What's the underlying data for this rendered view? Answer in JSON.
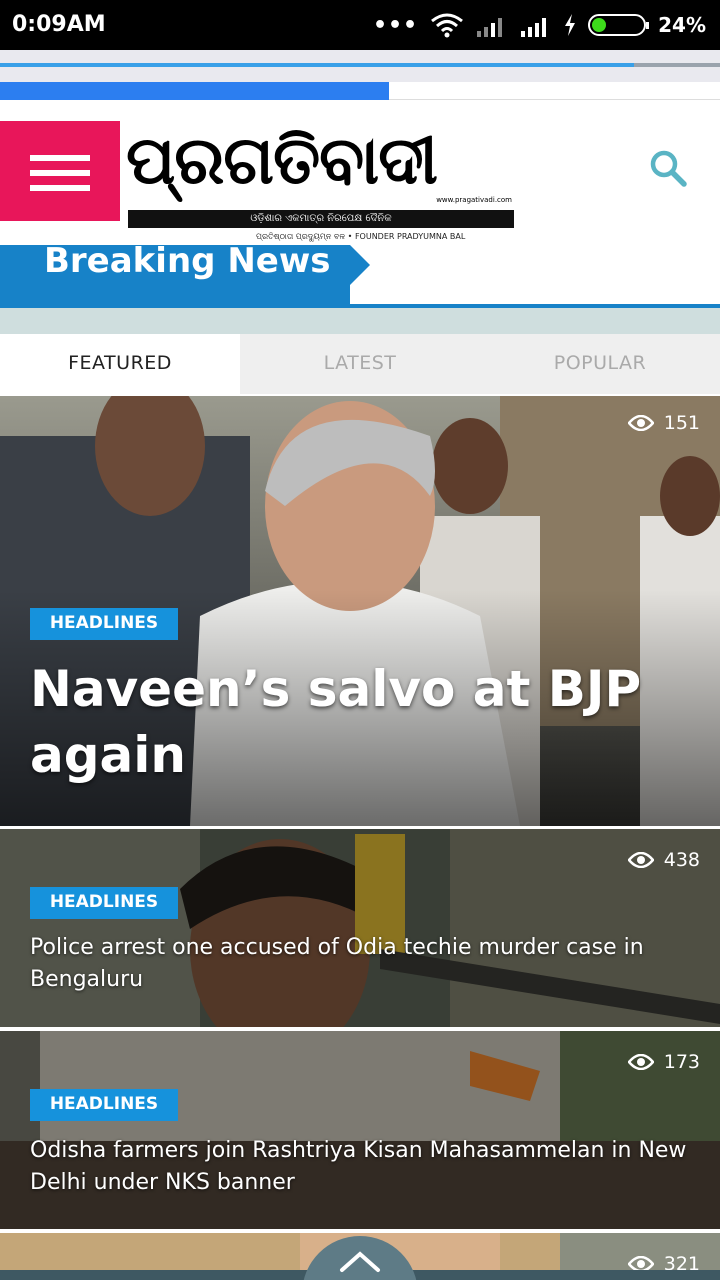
{
  "status_bar": {
    "time": "0:09AM",
    "dots": "•••",
    "battery_percent": "24%",
    "battery_level": 0.24,
    "icons": [
      "wifi-icon",
      "signal-icon",
      "signal-icon",
      "charging-icon",
      "battery-icon"
    ]
  },
  "loading": {
    "page_progress": 0.88,
    "secondary_progress": 0.54
  },
  "header": {
    "menu_icon": "hamburger-icon",
    "logo_text": "ପ୍ରଗତିବାଦୀ",
    "logo_url": "www.pragativadi.com",
    "logo_tagline": "ଓଡ଼ିଶାର ଏକମାତ୍ର ନିରପେକ୍ଷ ଦୈନିକ",
    "logo_founder": "ପ୍ରତିଷ୍ଠାତା ପ୍ରଦ୍ୟୁମ୍ନ ବଳ • FOUNDER PRADYUMNA BAL",
    "search_icon": "search-icon",
    "brand_color": "#e8165a"
  },
  "breaking": {
    "label": "Breaking News",
    "color": "#1782c8"
  },
  "tabs": [
    {
      "label": "FEATURED",
      "active": true
    },
    {
      "label": "LATEST",
      "active": false
    },
    {
      "label": "POPULAR",
      "active": false
    }
  ],
  "articles": [
    {
      "views": "151",
      "category": "HEADLINES",
      "title": "Naveen’s salvo at BJP again"
    },
    {
      "views": "438",
      "category": "HEADLINES",
      "title": "Police arrest one accused of Odia techie murder case in Bengaluru"
    },
    {
      "views": "173",
      "category": "HEADLINES",
      "title": "Odisha farmers join Rashtriya Kisan Mahasammelan in New Delhi under NKS banner"
    },
    {
      "views": "321"
    }
  ],
  "scroll_top_icon": "chevron-up-icon"
}
